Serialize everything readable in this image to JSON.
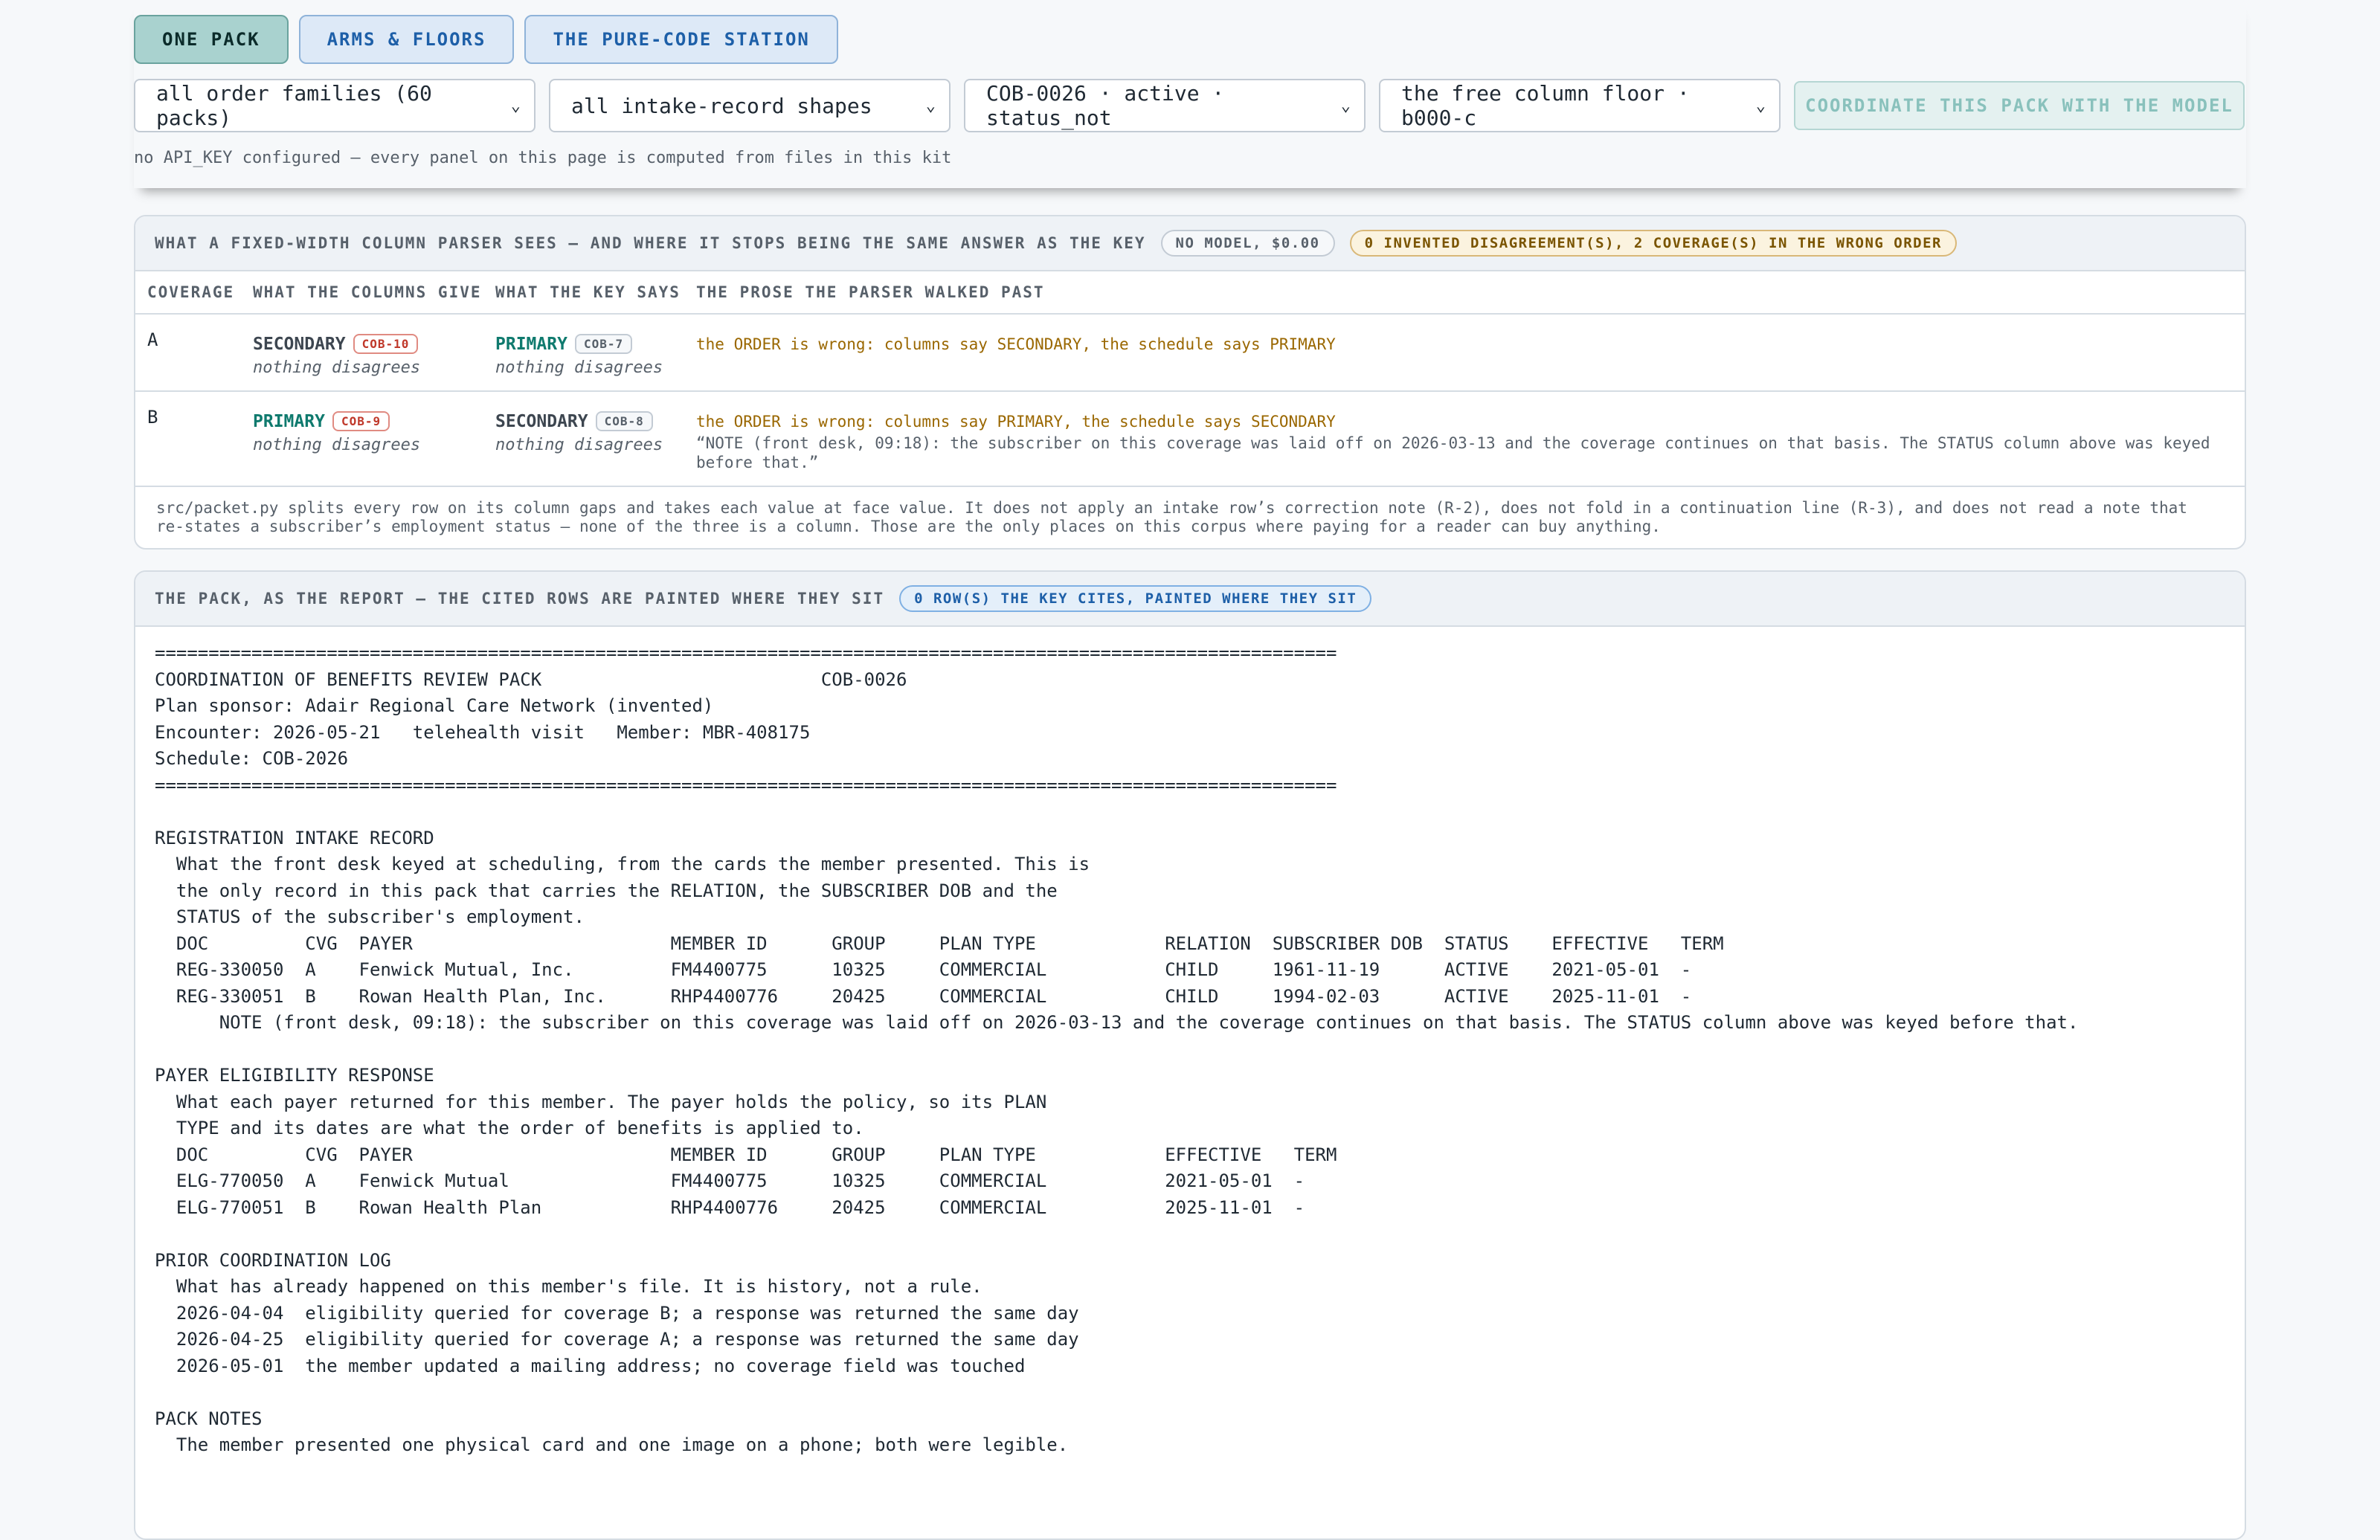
{
  "tabs": [
    {
      "label": "ONE PACK",
      "active": true
    },
    {
      "label": "ARMS & FLOORS",
      "active": false
    },
    {
      "label": "THE PURE-CODE STATION",
      "active": false
    }
  ],
  "controls": {
    "family_select": "all order families (60 packs)",
    "shape_select": "all intake-record shapes",
    "pack_select": "COB-0026 · active · status_not",
    "floor_select": "the free column floor · b000-c",
    "coordinate_button": "COORDINATE THIS PACK WITH THE MODEL",
    "api_note": "no API_KEY configured — every panel on this page is computed from files in this kit"
  },
  "parser_panel": {
    "title": "WHAT A FIXED-WIDTH COLUMN PARSER SEES — AND WHERE IT STOPS BEING THE SAME ANSWER AS THE KEY",
    "cost_pill": "NO MODEL, $0.00",
    "result_pill": "0 INVENTED DISAGREEMENT(S), 2 COVERAGE(S) IN THE WRONG ORDER",
    "headers": [
      "COVERAGE",
      "WHAT THE COLUMNS GIVE",
      "WHAT THE KEY SAYS",
      "THE PROSE THE PARSER WALKED PAST"
    ],
    "rows": [
      {
        "coverage": "A",
        "columns_value": "SECONDARY",
        "columns_tag": "COB-10",
        "columns_sub": "nothing disagrees",
        "key_value": "PRIMARY",
        "key_tag": "COB-7",
        "key_sub": "nothing disagrees",
        "prose_wrong": "the ORDER is wrong: columns say SECONDARY, the schedule says PRIMARY",
        "prose_quote": ""
      },
      {
        "coverage": "B",
        "columns_value": "PRIMARY",
        "columns_tag": "COB-9",
        "columns_sub": "nothing disagrees",
        "key_value": "SECONDARY",
        "key_tag": "COB-8",
        "key_sub": "nothing disagrees",
        "prose_wrong": "the ORDER is wrong: columns say PRIMARY, the schedule says SECONDARY",
        "prose_quote": "“NOTE (front desk, 09:18): the subscriber on this coverage was laid off on 2026-03-13 and the coverage continues on that basis. The STATUS column above was keyed before that.”"
      }
    ],
    "footnote": "src/packet.py splits every row on its column gaps and takes each value at face value. It does not apply an intake row’s correction note (R-2), does not fold in a continuation line (R-3), and does not read a note that re-states a subscriber’s employment status — none of the three is a column. Those are the only places on this corpus where paying for a reader can buy anything."
  },
  "report_panel": {
    "title": "THE PACK, AS THE REPORT — THE CITED ROWS ARE PAINTED WHERE THEY SIT",
    "pill": "0 ROW(S) THE KEY CITES, PAINTED WHERE THEY SIT",
    "lines": [
      "==============================================================================================================",
      "COORDINATION OF BENEFITS REVIEW PACK                          COB-0026",
      "Plan sponsor: Adair Regional Care Network (invented)",
      "Encounter: 2026-05-21   telehealth visit   Member: MBR-408175",
      "Schedule: COB-2026",
      "==============================================================================================================",
      "",
      "REGISTRATION INTAKE RECORD",
      "  What the front desk keyed at scheduling, from the cards the member presented. This is",
      "  the only record in this pack that carries the RELATION, the SUBSCRIBER DOB and the",
      "  STATUS of the subscriber's employment.",
      "  DOC         CVG  PAYER                        MEMBER ID      GROUP     PLAN TYPE            RELATION  SUBSCRIBER DOB  STATUS    EFFECTIVE   TERM",
      "  REG-330050  A    Fenwick Mutual, Inc.         FM4400775      10325     COMMERCIAL           CHILD     1961-11-19      ACTIVE    2021-05-01  -",
      "  REG-330051  B    Rowan Health Plan, Inc.      RHP4400776     20425     COMMERCIAL           CHILD     1994-02-03      ACTIVE    2025-11-01  -",
      "      NOTE (front desk, 09:18): the subscriber on this coverage was laid off on 2026-03-13 and the coverage continues on that basis. The STATUS column above was keyed before that.",
      "",
      "PAYER ELIGIBILITY RESPONSE",
      "  What each payer returned for this member. The payer holds the policy, so its PLAN",
      "  TYPE and its dates are what the order of benefits is applied to.",
      "  DOC         CVG  PAYER                        MEMBER ID      GROUP     PLAN TYPE            EFFECTIVE   TERM",
      "  ELG-770050  A    Fenwick Mutual               FM4400775      10325     COMMERCIAL           2021-05-01  -",
      "  ELG-770051  B    Rowan Health Plan            RHP4400776     20425     COMMERCIAL           2025-11-01  -",
      "",
      "PRIOR COORDINATION LOG",
      "  What has already happened on this member's file. It is history, not a rule.",
      "  2026-04-04  eligibility queried for coverage B; a response was returned the same day",
      "  2026-04-25  eligibility queried for coverage A; a response was returned the same day",
      "  2026-05-01  the member updated a mailing address; no coverage field was touched",
      "",
      "PACK NOTES",
      "  The member presented one physical card and one image on a phone; both were legible."
    ]
  }
}
